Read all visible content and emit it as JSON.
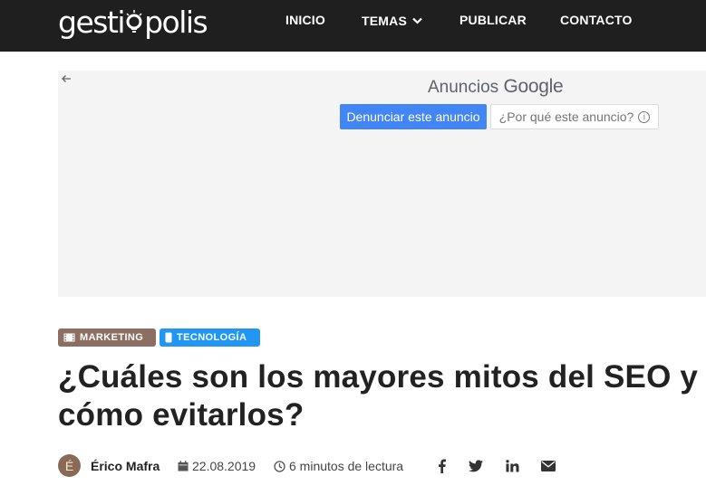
{
  "header": {
    "logo_text_left": "gesti",
    "logo_text_right": "polis",
    "nav": [
      "INICIO",
      "TEMAS",
      "PUBLICAR",
      "CONTACTO"
    ],
    "bg_color": "#1f1f1f"
  },
  "ad": {
    "label_prefix": "Anuncios",
    "label_brand": "Google",
    "report_button": "Denunciar este anuncio",
    "why_button": "¿Por qué este anuncio?",
    "icons": [
      "back-arrow-icon",
      "info-icon"
    ]
  },
  "article": {
    "categories": [
      {
        "label": "MARKETING",
        "color": "#8c6f62",
        "icon": "film-icon"
      },
      {
        "label": "TECNOLOGÍA",
        "color": "#2196f3",
        "icon": "mobile-icon"
      }
    ],
    "title": "¿Cuáles son los mayores mitos del SEO y cómo evitarlos?",
    "author_initial": "É",
    "author": "Érico Mafra",
    "date": "22.08.2019",
    "reading_time": "6 minutos de lectura",
    "share_icons": [
      "facebook-icon",
      "twitter-icon",
      "linkedin-icon",
      "email-icon"
    ]
  }
}
